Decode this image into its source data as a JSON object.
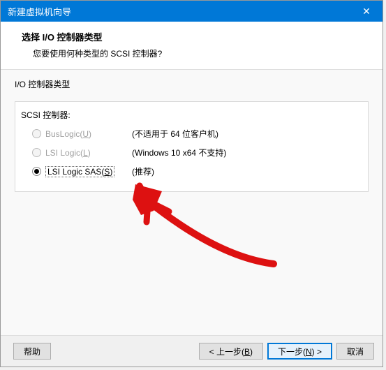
{
  "window": {
    "title": "新建虚拟机向导",
    "close_glyph": "✕"
  },
  "header": {
    "title": "选择 I/O 控制器类型",
    "subtitle": "您要使用何种类型的 SCSI 控制器?"
  },
  "group": {
    "legend": "I/O 控制器类型",
    "subsection_label": "SCSI 控制器:",
    "options": [
      {
        "label_pre": "BusLogic(",
        "mnemonic": "U",
        "label_post": ")",
        "note": "(不适用于 64 位客户机)",
        "enabled": false,
        "selected": false
      },
      {
        "label_pre": "LSI Logic(",
        "mnemonic": "L",
        "label_post": ")",
        "note": "(Windows 10 x64 不支持)",
        "enabled": false,
        "selected": false
      },
      {
        "label_pre": "LSI Logic SAS(",
        "mnemonic": "S",
        "label_post": ")",
        "note": "(推荐)",
        "enabled": true,
        "selected": true
      }
    ]
  },
  "footer": {
    "help": "帮助",
    "back_pre": "< 上一步(",
    "back_mn": "B",
    "back_post": ")",
    "next_pre": "下一步(",
    "next_mn": "N",
    "next_post": ") >",
    "cancel": "取消"
  }
}
